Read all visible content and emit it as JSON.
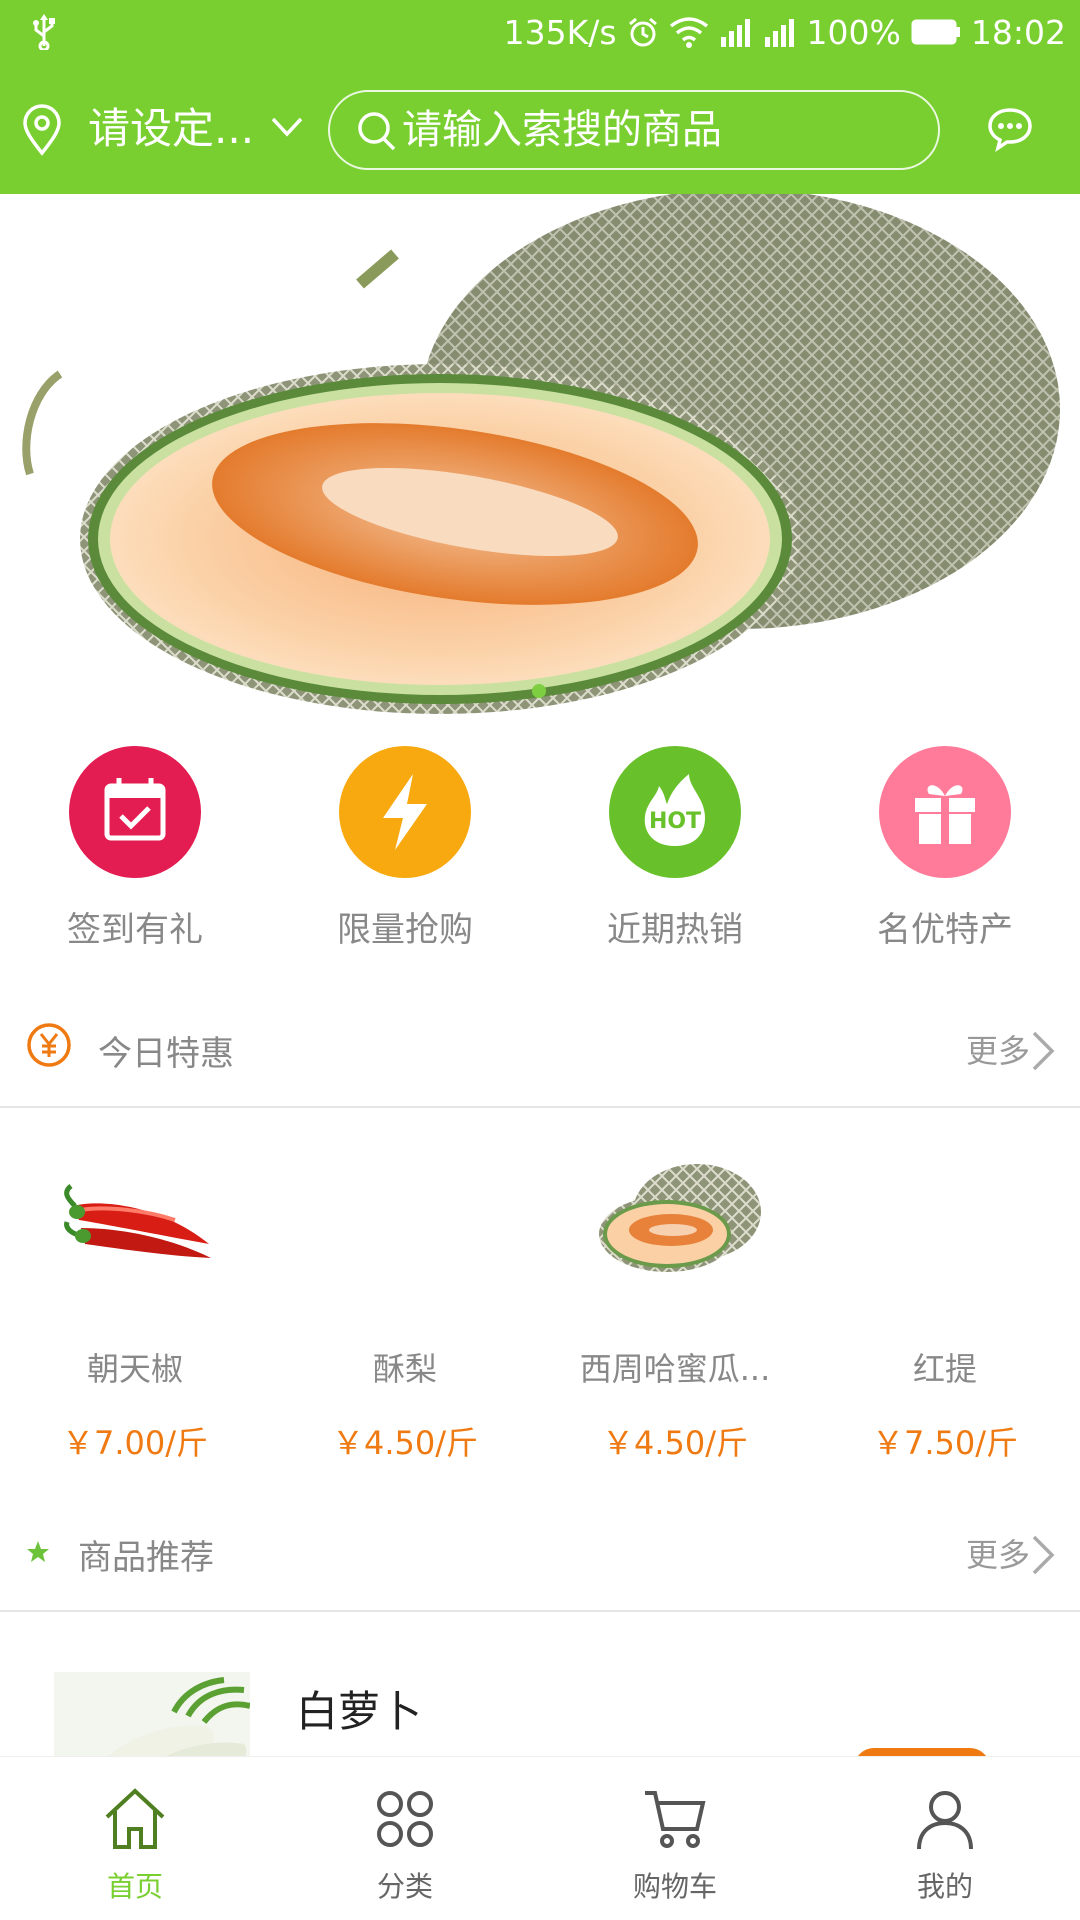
{
  "status_bar": {
    "speed": "135K/s",
    "battery": "100%",
    "time": "18:02"
  },
  "header": {
    "location_label": "请设定...",
    "search_placeholder": "请输入索搜的商品"
  },
  "banner": {
    "slide_index": 1,
    "slide_count": 1
  },
  "quick_nav": [
    {
      "label": "签到有礼",
      "icon": "calendar-check-icon",
      "color": "#e31c52"
    },
    {
      "label": "限量抢购",
      "icon": "lightning-icon",
      "color": "#f7a90f"
    },
    {
      "label": "近期热销",
      "icon": "hot-flame-icon",
      "color": "#68c12a"
    },
    {
      "label": "名优特产",
      "icon": "gift-icon",
      "color": "#ff7b99"
    }
  ],
  "today_deals": {
    "title": "今日特惠",
    "more": "更多",
    "items": [
      {
        "name": "朝天椒",
        "price": "￥7.00/斤",
        "image": "chili-pepper"
      },
      {
        "name": "酥梨",
        "price": "￥4.50/斤",
        "image": ""
      },
      {
        "name": "西周哈蜜瓜...",
        "price": "￥4.50/斤",
        "image": "hami-melon"
      },
      {
        "name": "红提",
        "price": "￥7.50/斤",
        "image": ""
      }
    ]
  },
  "recommend": {
    "title": "商品推荐",
    "more": "更多",
    "items": [
      {
        "name": "白萝卜",
        "image": "white-radish"
      }
    ]
  },
  "tab_bar": [
    {
      "label": "首页",
      "icon": "home-icon",
      "active": true
    },
    {
      "label": "分类",
      "icon": "category-icon",
      "active": false
    },
    {
      "label": "购物车",
      "icon": "cart-icon",
      "active": false
    },
    {
      "label": "我的",
      "icon": "user-icon",
      "active": false
    }
  ],
  "colors": {
    "brand_green": "#78cf2f",
    "price_orange": "#f07a12"
  }
}
